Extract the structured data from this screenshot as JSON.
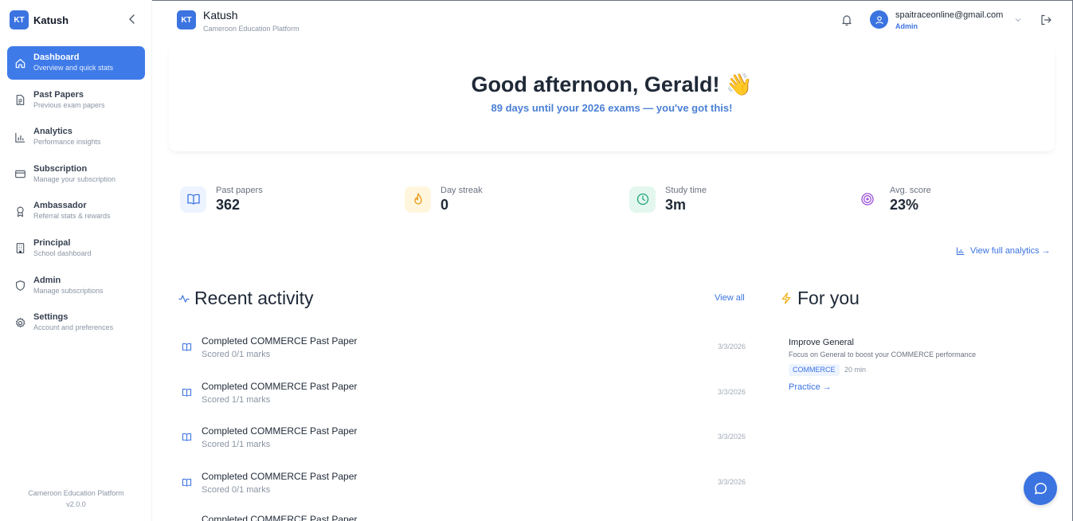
{
  "sidebar": {
    "logo": "KT",
    "brand": "Katush",
    "items": [
      {
        "label": "Dashboard",
        "sub": "Overview and quick stats",
        "icon": "home-icon"
      },
      {
        "label": "Past Papers",
        "sub": "Previous exam papers",
        "icon": "document-icon"
      },
      {
        "label": "Analytics",
        "sub": "Performance insights",
        "icon": "bar-chart-icon"
      },
      {
        "label": "Subscription",
        "sub": "Manage your subscription",
        "icon": "credit-card-icon"
      },
      {
        "label": "Ambassador",
        "sub": "Referral stats & rewards",
        "icon": "award-icon"
      },
      {
        "label": "Principal",
        "sub": "School dashboard",
        "icon": "building-icon"
      },
      {
        "label": "Admin",
        "sub": "Manage subscriptions",
        "icon": "shield-icon"
      },
      {
        "label": "Settings",
        "sub": "Account and preferences",
        "icon": "gear-icon"
      }
    ],
    "footer_name": "Cameroon Education Platform",
    "footer_version": "v2.0.0"
  },
  "header": {
    "logo": "KT",
    "title": "Katush",
    "subtitle": "Cameroon Education Platform",
    "email": "spaitraceonline@gmail.com",
    "role": "Admin"
  },
  "greeting": {
    "title": "Good afternoon, Gerald! 👋",
    "subtitle": "89 days until your 2026 exams — you've got this!"
  },
  "stats": [
    {
      "label": "Past papers",
      "value": "362",
      "color": "#3b73e0",
      "bg": "#eef4ff"
    },
    {
      "label": "Day streak",
      "value": "0",
      "color": "#e89a1a",
      "bg": "#fff6dd"
    },
    {
      "label": "Study time",
      "value": "3m",
      "color": "#1ea57a",
      "bg": "#e3f7ef"
    },
    {
      "label": "Avg. score",
      "value": "23%",
      "color": "#9b4fd8",
      "bg": "#ffffff"
    }
  ],
  "analytics_link": "View full analytics →",
  "recent": {
    "title": "Recent activity",
    "view_all": "View all",
    "items": [
      {
        "title": "Completed COMMERCE Past Paper",
        "sub": "Scored 0/1 marks",
        "date": "3/3/2026"
      },
      {
        "title": "Completed COMMERCE Past Paper",
        "sub": "Scored 1/1 marks",
        "date": "3/3/2026"
      },
      {
        "title": "Completed COMMERCE Past Paper",
        "sub": "Scored 1/1 marks",
        "date": "3/3/2026"
      },
      {
        "title": "Completed COMMERCE Past Paper",
        "sub": "Scored 0/1 marks",
        "date": "3/3/2026"
      },
      {
        "title": "Completed COMMERCE Past Paper",
        "sub": "",
        "date": ""
      }
    ]
  },
  "for_you": {
    "title": "For you",
    "card_title": "Improve General",
    "card_desc": "Focus on General to boost your COMMERCE performance",
    "tag": "COMMERCE",
    "duration": "20 min",
    "link": "Practice →"
  },
  "colors": {
    "accent": "#3b73e0",
    "active_nav": "#3f7be8"
  }
}
